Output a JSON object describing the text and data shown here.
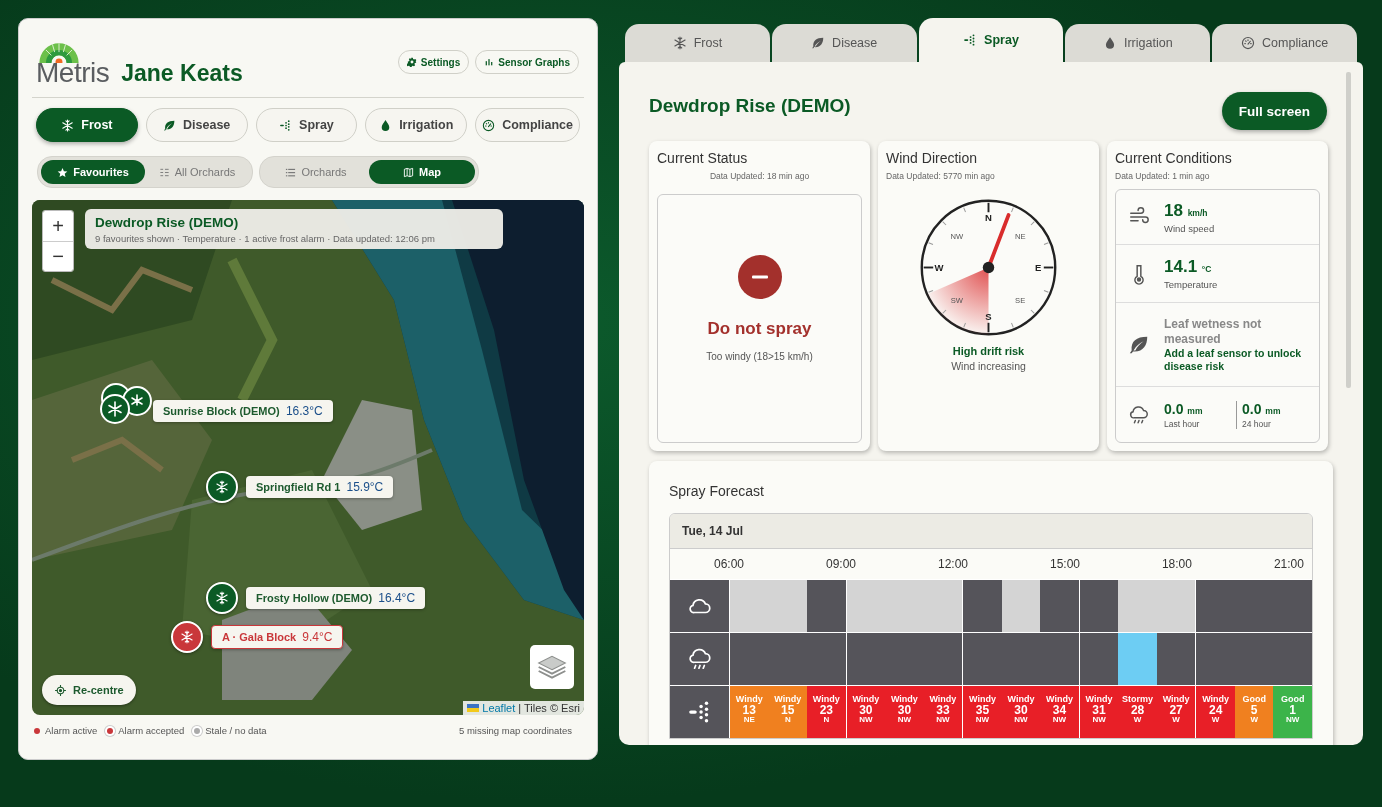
{
  "header": {
    "logo_text": "Metris",
    "user": "Jane Keats",
    "buttons": [
      {
        "kind": "settings",
        "label": "Settings"
      },
      {
        "kind": "graphs",
        "label": "Sensor Graphs"
      }
    ]
  },
  "modules": [
    {
      "kind": "frost",
      "label": "Frost",
      "selected": true
    },
    {
      "kind": "disease",
      "label": "Disease",
      "selected": false
    },
    {
      "kind": "spray",
      "label": "Spray",
      "selected": false
    },
    {
      "kind": "irrigation",
      "label": "Irrigation",
      "selected": false
    },
    {
      "kind": "compliance",
      "label": "Compliance",
      "selected": false
    }
  ],
  "filters": [
    {
      "kind": "star",
      "label": "Favourites",
      "selected": true
    },
    {
      "kind": "grid",
      "label": "All Orchards",
      "selected": false
    }
  ],
  "views": [
    {
      "kind": "list",
      "label": "Orchards",
      "selected": false
    },
    {
      "kind": "map",
      "label": "Map",
      "selected": true
    }
  ],
  "map": {
    "zoom_in": "+",
    "zoom_out": "−",
    "overlay": {
      "title": "Dewdrop Rise (DEMO)",
      "subtitle": "9 favourites shown · Temperature · 1 active frost alarm · Data updated: 12:06 pm"
    },
    "markers": [
      {
        "kind": "cluster",
        "name": "Sunrise Block (DEMO)",
        "temp": "16.3°C",
        "alarm": false
      },
      {
        "name": "Springfield Rd 1",
        "temp": "15.9°C",
        "alarm": false
      },
      {
        "name": "Frosty Hollow (DEMO)",
        "temp": "16.4°C",
        "alarm": false
      },
      {
        "name": "A · Gala Block",
        "temp": "9.4°C",
        "alarm": true
      }
    ],
    "recentre": "Re-centre",
    "attribution": {
      "link": "Leaflet",
      "text": "| Tiles © Esri"
    }
  },
  "legend": {
    "items": [
      {
        "kind": "active",
        "label": "Alarm active"
      },
      {
        "kind": "accepted",
        "label": "Alarm accepted"
      },
      {
        "kind": "stale",
        "label": "Stale / no data"
      }
    ],
    "note": "5 missing map coordinates"
  },
  "tabs": [
    {
      "kind": "frost",
      "label": "Frost",
      "selected": false
    },
    {
      "kind": "disease",
      "label": "Disease",
      "selected": false
    },
    {
      "kind": "spray",
      "label": "Spray",
      "selected": true
    },
    {
      "kind": "irrigation",
      "label": "Irrigation",
      "selected": false
    },
    {
      "kind": "compliance",
      "label": "Compliance",
      "selected": false
    }
  ],
  "site": {
    "title": "Dewdrop Rise (DEMO)",
    "button": "Full screen"
  },
  "status": {
    "title": "Current Status",
    "updated": "Data Updated: 18 min ago",
    "kind": "stop",
    "verdict": "Do not spray",
    "reason": "Too windy (18>15 km/h)"
  },
  "wind": {
    "title": "Wind Direction",
    "updated": "Data Updated: 5770 min ago",
    "points": [
      "N",
      "NE",
      "E",
      "SE",
      "S",
      "SW",
      "W",
      "NW"
    ],
    "risk": "High drift risk",
    "trend": "Wind increasing"
  },
  "conditions": {
    "title": "Current Conditions",
    "updated": "Data Updated: 1 min ago",
    "rows": [
      {
        "kind": "wind",
        "value": "18",
        "unit": "km/h",
        "label": "Wind speed"
      },
      {
        "kind": "temp",
        "value": "14.1",
        "unit": "°C",
        "label": "Temperature"
      },
      {
        "kind": "leaf",
        "label": "Leaf wetness not measured",
        "hint": "Add a leaf sensor to unlock disease risk"
      },
      {
        "kind": "rain",
        "readings": [
          {
            "value": "0.0",
            "unit": "mm",
            "label": "Last hour"
          },
          {
            "value": "0.0",
            "unit": "mm",
            "label": "24 hour"
          }
        ]
      }
    ]
  },
  "forecast": {
    "title": "Spray Forecast",
    "date": "Tue, 14 Jul",
    "times": [
      "06:00",
      "09:00",
      "12:00",
      "15:00",
      "18:00",
      "21:00"
    ],
    "cells": [
      {
        "cloud": true,
        "rain": false,
        "label": "Windy",
        "speed": "13",
        "dir": "NE",
        "color": "#f0801f"
      },
      {
        "cloud": true,
        "rain": false,
        "label": "Windy",
        "speed": "15",
        "dir": "N",
        "color": "#f0801f"
      },
      {
        "cloud": false,
        "rain": false,
        "label": "Windy",
        "speed": "23",
        "dir": "N",
        "color": "#e81f27"
      },
      {
        "cloud": true,
        "rain": false,
        "label": "Windy",
        "speed": "30",
        "dir": "NW",
        "color": "#e81f27"
      },
      {
        "cloud": true,
        "rain": false,
        "label": "Windy",
        "speed": "30",
        "dir": "NW",
        "color": "#e81f27"
      },
      {
        "cloud": true,
        "rain": false,
        "label": "Windy",
        "speed": "33",
        "dir": "NW",
        "color": "#e81f27"
      },
      {
        "cloud": false,
        "rain": false,
        "label": "Windy",
        "speed": "35",
        "dir": "NW",
        "color": "#e81f27"
      },
      {
        "cloud": true,
        "rain": false,
        "label": "Windy",
        "speed": "30",
        "dir": "NW",
        "color": "#e81f27"
      },
      {
        "cloud": false,
        "rain": false,
        "label": "Windy",
        "speed": "34",
        "dir": "NW",
        "color": "#e81f27"
      },
      {
        "cloud": false,
        "rain": false,
        "label": "Windy",
        "speed": "31",
        "dir": "NW",
        "color": "#e81f27"
      },
      {
        "cloud": true,
        "rain": true,
        "label": "Stormy",
        "speed": "28",
        "dir": "W",
        "color": "#e81f27"
      },
      {
        "cloud": true,
        "rain": false,
        "label": "Windy",
        "speed": "27",
        "dir": "W",
        "color": "#e81f27"
      },
      {
        "cloud": false,
        "rain": false,
        "label": "Windy",
        "speed": "24",
        "dir": "W",
        "color": "#e81f27"
      },
      {
        "cloud": false,
        "rain": false,
        "label": "Good",
        "speed": "5",
        "dir": "W",
        "color": "#f0801f"
      },
      {
        "cloud": false,
        "rain": false,
        "label": "Good",
        "speed": "1",
        "dir": "NW",
        "color": "#3cb44a"
      }
    ]
  }
}
